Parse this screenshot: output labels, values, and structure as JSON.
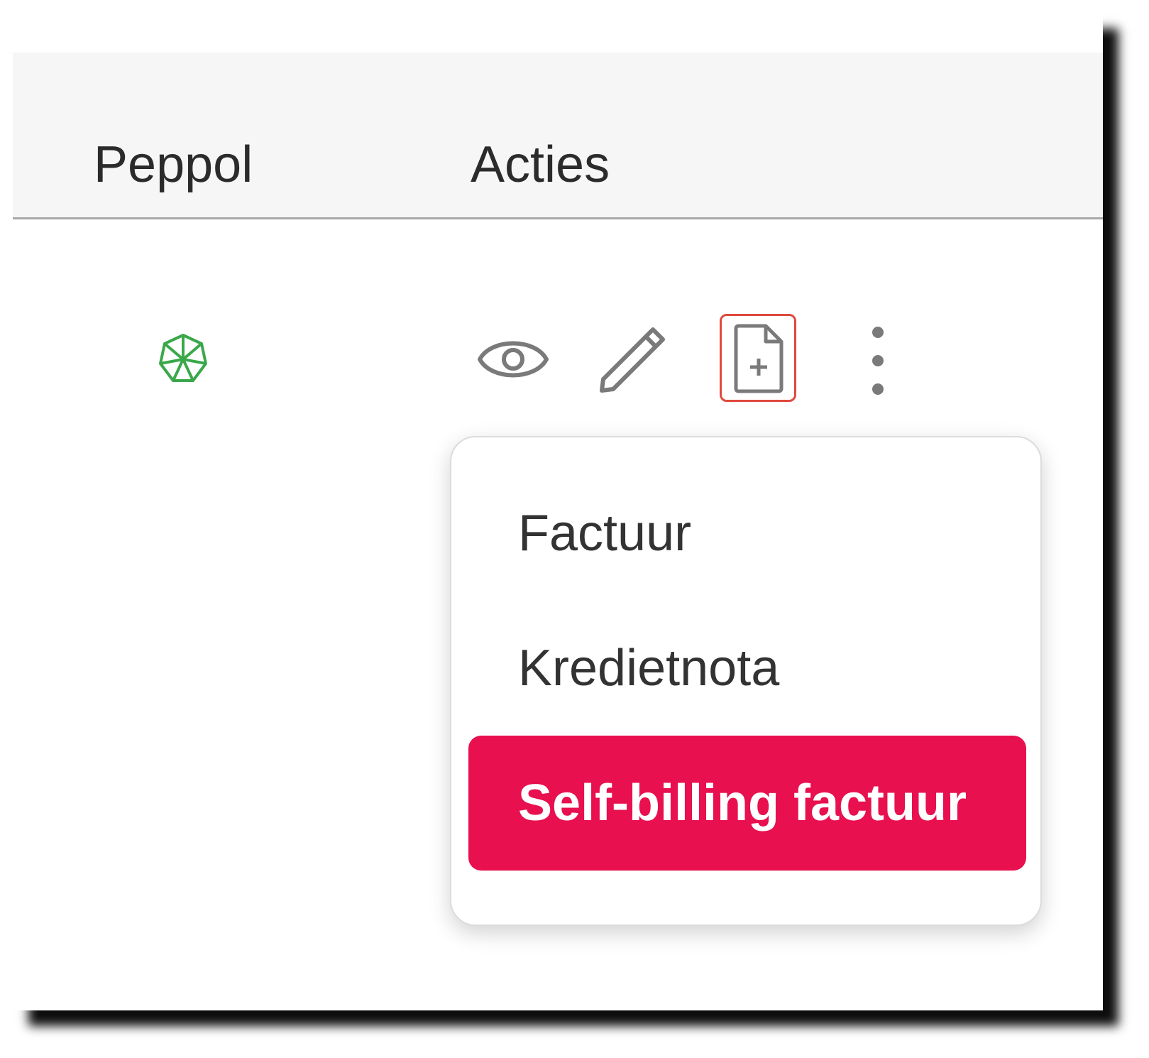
{
  "table": {
    "columns": [
      {
        "label": "Peppol"
      },
      {
        "label": "Acties"
      }
    ],
    "row": {
      "peppol_status_icon": "peppol-network-icon",
      "actions": [
        {
          "icon": "eye-icon",
          "name": "view"
        },
        {
          "icon": "pencil-icon",
          "name": "edit"
        },
        {
          "icon": "document-plus-icon",
          "name": "new-document",
          "highlighted": true
        },
        {
          "icon": "vertical-dots-icon",
          "name": "more"
        }
      ]
    }
  },
  "dropdown": {
    "items": [
      {
        "label": "Factuur"
      },
      {
        "label": "Kredietnota"
      },
      {
        "label": "Self-billing factuur",
        "active": true
      }
    ]
  },
  "colors": {
    "accent": "#e8104f",
    "highlight_border": "#e0493c",
    "peppol_green": "#3aa84a",
    "icon_gray": "#7a7a7a"
  }
}
